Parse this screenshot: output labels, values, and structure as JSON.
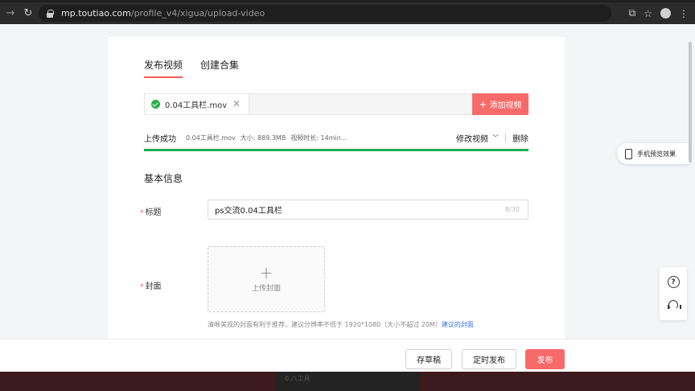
{
  "browser": {
    "url_host": "mp.toutiao.com",
    "url_path": "/profile_v4/xigua/upload-video"
  },
  "tabs": [
    {
      "label": "发布视频",
      "active": true
    },
    {
      "label": "创建合集",
      "active": false
    }
  ],
  "upload": {
    "file_name": "0.04工具栏.mov",
    "add_label": "添加视频"
  },
  "status": {
    "state": "上传成功",
    "file": "0.04工具栏.mov",
    "size": "大小: 889.3MB",
    "duration": "视频时长: 14min...",
    "modify_label": "修改视频",
    "delete_label": "删除",
    "progress": 1.0
  },
  "section_title": "基本信息",
  "form": {
    "title_label": "标题",
    "title_value": "ps交流0.04工具栏",
    "title_counter": "8/30",
    "cover_label": "封面",
    "cover_upload_label": "上传封面",
    "cover_hint": "清晰美观的封面有利于推荐，建议分辨率不低于 1920*1080（大小不超过 20M）",
    "cover_hint_link": "建议的封面"
  },
  "side": {
    "preview_label": "手机预览效果"
  },
  "actions": {
    "draft": "存草稿",
    "schedule": "定时发布",
    "publish": "发布"
  },
  "background_strip_text": "0.八工具",
  "colors": {
    "accent": "#f76a6a",
    "success": "#1fad4f",
    "link": "#3a6fd8"
  }
}
